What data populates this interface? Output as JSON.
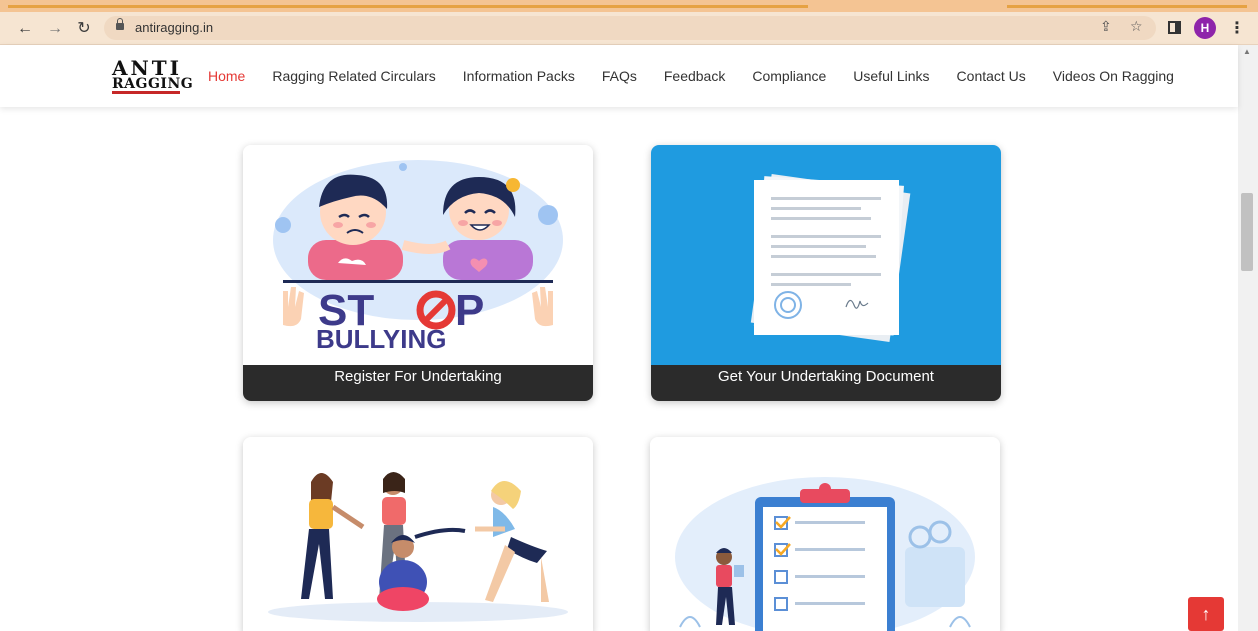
{
  "browser": {
    "url": "antiragging.in",
    "profile_initial": "H",
    "icons": [
      "back-arrow-icon",
      "forward-arrow-icon",
      "reload-icon",
      "lock-icon",
      "share-icon",
      "bookmark-star-icon",
      "side-panel-icon",
      "kebab-menu-icon"
    ]
  },
  "site": {
    "logo": {
      "line1": "ANTI",
      "line2": "RAGGING"
    },
    "nav": [
      {
        "label": "Home",
        "active": true
      },
      {
        "label": "Ragging Related Circulars"
      },
      {
        "label": "Information Packs"
      },
      {
        "label": "FAQs"
      },
      {
        "label": "Feedback"
      },
      {
        "label": "Compliance"
      },
      {
        "label": "Useful Links"
      },
      {
        "label": "Contact Us"
      },
      {
        "label": "Videos On Ragging"
      }
    ]
  },
  "cards": [
    {
      "caption": "Register For Undertaking",
      "art_text": {
        "stop": "ST",
        "stop_end": "P",
        "bullying": "BULLYING"
      }
    },
    {
      "caption": "Get Your Undertaking Document"
    },
    {
      "caption": ""
    },
    {
      "caption": ""
    }
  ],
  "colors": {
    "accent": "#e53935",
    "card_caption_bg": "#2b2b2b",
    "doc_card_bg": "#1f9be0"
  }
}
